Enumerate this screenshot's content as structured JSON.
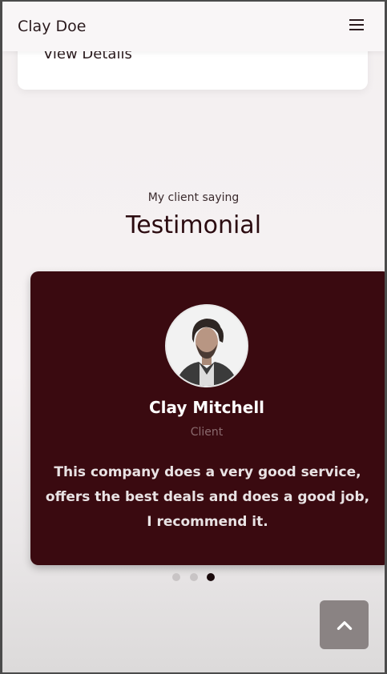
{
  "header": {
    "brand": "Clay Doe",
    "menu_icon": "hamburger-icon"
  },
  "previous_section": {
    "link_label": "View Details"
  },
  "testimonials": {
    "subtitle": "My client saying",
    "title": "Testimonial",
    "card": {
      "name": "Clay Mitchell",
      "role": "Client",
      "quote": "This company does a very good service, offers the best deals and does a good job, I recommend it.",
      "background_color": "#3a0a10"
    },
    "pagination": {
      "count": 3,
      "active_index": 2
    }
  },
  "back_to_top": {
    "icon": "chevron-up-icon"
  }
}
